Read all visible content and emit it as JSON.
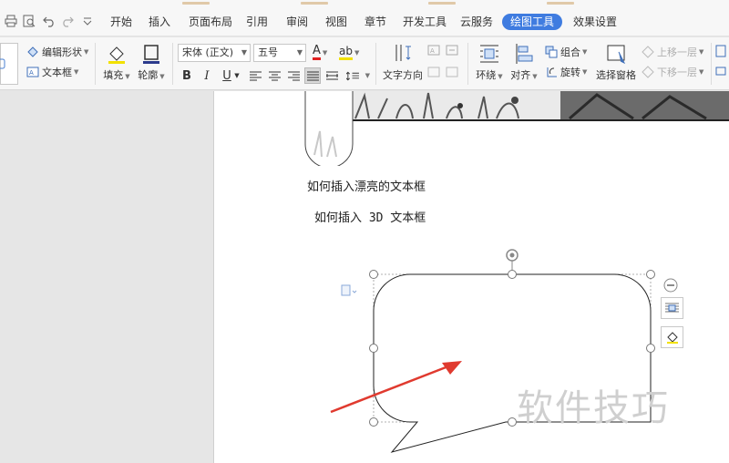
{
  "menu": {
    "tabs": [
      {
        "label": "开始"
      },
      {
        "label": "插入"
      },
      {
        "label": "页面布局"
      },
      {
        "label": "引用"
      },
      {
        "label": "审阅"
      },
      {
        "label": "视图"
      },
      {
        "label": "章节"
      },
      {
        "label": "开发工具"
      },
      {
        "label": "云服务"
      },
      {
        "label": "绘图工具",
        "active": true
      },
      {
        "label": "效果设置"
      }
    ]
  },
  "ribbon": {
    "edit_shape": "编辑形状",
    "text_box": "文本框",
    "fill": "填充",
    "outline": "轮廓",
    "font_family": "宋体 (正文)",
    "font_size": "五号",
    "font_color_glyph": "A",
    "highlight_glyph": "ab",
    "bold": "B",
    "italic": "I",
    "underline": "U",
    "text_direction": "文字方向",
    "wrap": "环绕",
    "align": "对齐",
    "group": "组合",
    "rotate": "旋转",
    "selection_pane": "选择窗格",
    "bring_forward": "上移一层",
    "send_backward": "下移一层"
  },
  "document": {
    "line1": "如何插入漂亮的文本框",
    "line2": "如何插入 3D 文本框"
  },
  "watermark": "软件技巧",
  "colors": {
    "accent": "#3f7ce0",
    "arrow": "#e03a2f"
  }
}
